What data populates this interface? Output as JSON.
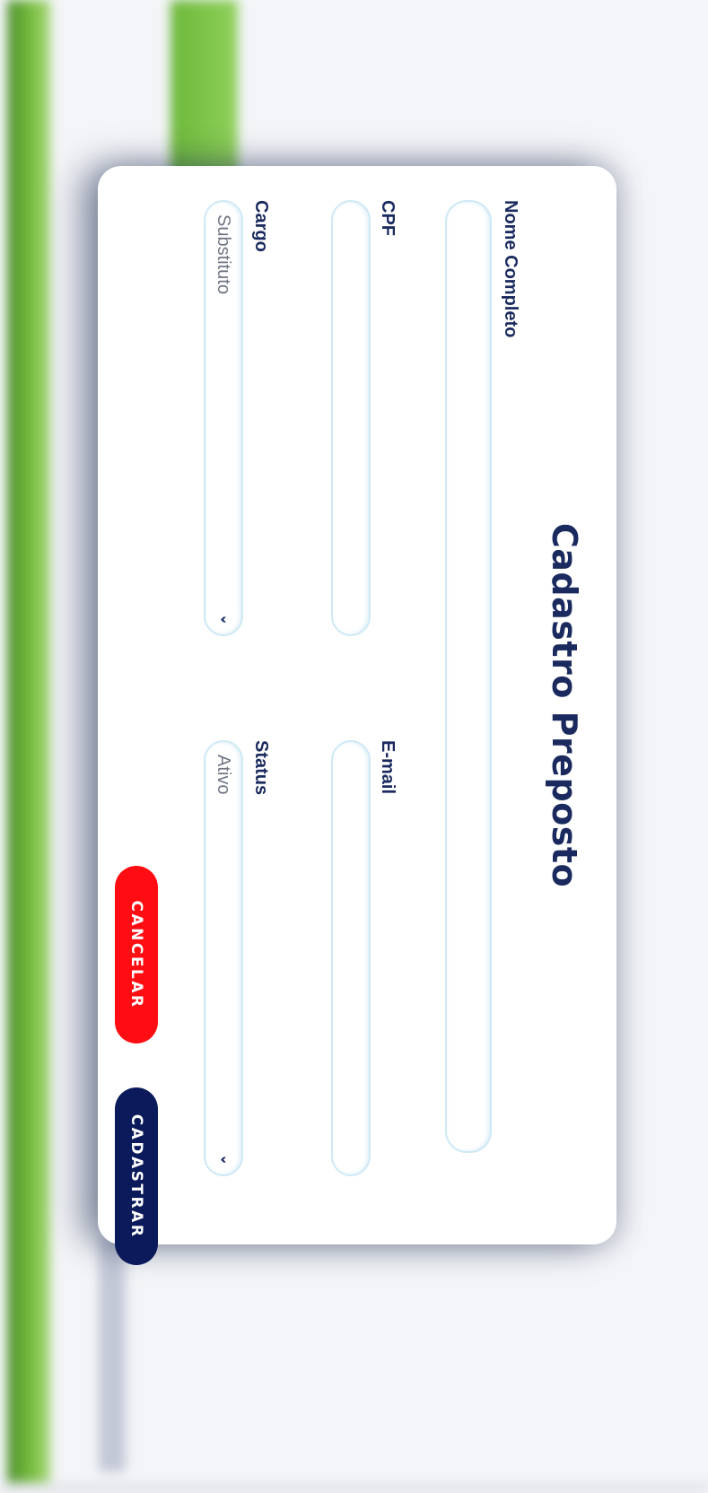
{
  "modal": {
    "title": "Cadastro Preposto",
    "fields": {
      "nome_completo": {
        "label": "Nome Completo",
        "value": ""
      },
      "cpf": {
        "label": "CPF",
        "value": ""
      },
      "email": {
        "label": "E-mail",
        "value": ""
      },
      "cargo": {
        "label": "Cargo",
        "value": "Substituto"
      },
      "status": {
        "label": "Status",
        "value": "Ativo"
      }
    },
    "buttons": {
      "cancel": "CANCELAR",
      "save": "CADASTRAR"
    }
  },
  "colors": {
    "accent_navy": "#1a2a5e",
    "cancel_red": "#ff0d12",
    "save_navy": "#0b1a5a",
    "brand_green": "#7cc043"
  },
  "icons": [
    "chevron-down-icon"
  ]
}
